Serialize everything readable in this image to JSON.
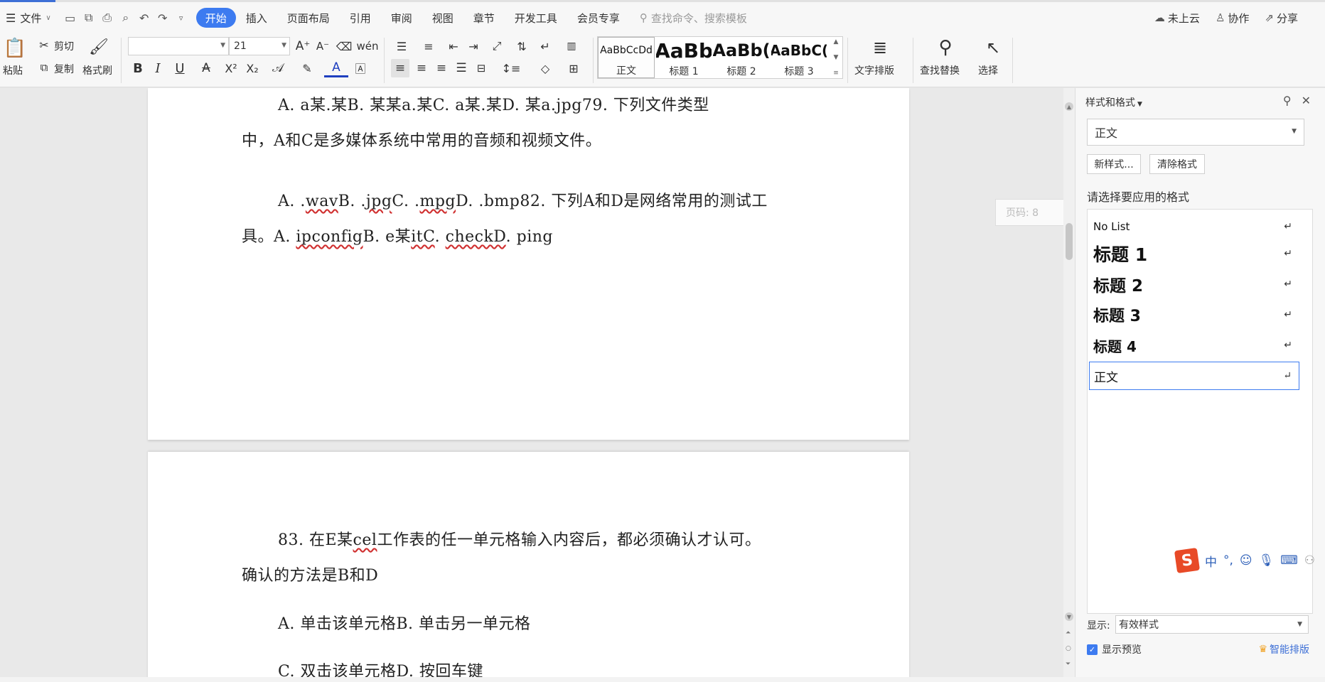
{
  "menu": {
    "file": "文件",
    "tabs": [
      "开始",
      "插入",
      "页面布局",
      "引用",
      "审阅",
      "视图",
      "章节",
      "开发工具",
      "会员专享"
    ],
    "search_placeholder": "查找命令、搜索模板",
    "cloud": "未上云",
    "collab": "协作",
    "share": "分享"
  },
  "ribbon": {
    "paste": "粘贴",
    "cut": "剪切",
    "copy": "复制",
    "format_painter": "格式刷",
    "font_name": "",
    "font_size": "21",
    "styles": [
      {
        "preview": "AaBbCcDd",
        "name": "正文"
      },
      {
        "preview": "AaBb",
        "name": "标题 1"
      },
      {
        "preview": "AaBb(",
        "name": "标题 2"
      },
      {
        "preview": "AaBbC(",
        "name": "标题 3"
      }
    ],
    "text_layout": "文字排版",
    "find_replace": "查找替换",
    "select": "选择"
  },
  "document": {
    "page1": {
      "p1_l1": "A. a某.某B. 某某a.某C. a某.某D. 某a.jpg79. 下列文件类型",
      "p1_l2": "中，A和C是多媒体系统中常用的音频和视频文件。",
      "p2_l1_a": "A. .",
      "p2_l1_b": "wav",
      "p2_l1_c": "B. .",
      "p2_l1_d": "jpg",
      "p2_l1_e": "C. .",
      "p2_l1_f": "mpg",
      "p2_l1_g": "D. .bmp82. 下列A和D是网络常用的测试工",
      "p2_l2_a": "具。A. ",
      "p2_l2_b": "ipconfig",
      "p2_l2_c": "B. e某",
      "p2_l2_d": "itC",
      "p2_l2_e": ". ",
      "p2_l2_f": "checkD",
      "p2_l2_g": ". ping"
    },
    "page2": {
      "p3_l1_a": "83. 在E某",
      "p3_l1_b": "cel",
      "p3_l1_c": "工作表的任一单元格输入内容后，都必须确认才认可。",
      "p3_l2": "确认的方法是B和D",
      "p4": "A. 单击该单元格B. 单击另一单元格",
      "p5": "C. 双击该单元格D. 按回车键"
    },
    "page_number_tip": "页码: 8"
  },
  "panel": {
    "title": "样式和格式",
    "current_style": "正文",
    "new_style": "新样式...",
    "clear_format": "清除格式",
    "hint": "请选择要应用的格式",
    "styles": [
      "No List",
      "标题 1",
      "标题 2",
      "标题 3",
      "标题 4",
      "正文"
    ],
    "show_label": "显示:",
    "show_value": "有效样式",
    "preview_label": "显示预览",
    "smart_layout": "智能排版"
  },
  "ime": {
    "logo": "S",
    "mode": "中"
  }
}
